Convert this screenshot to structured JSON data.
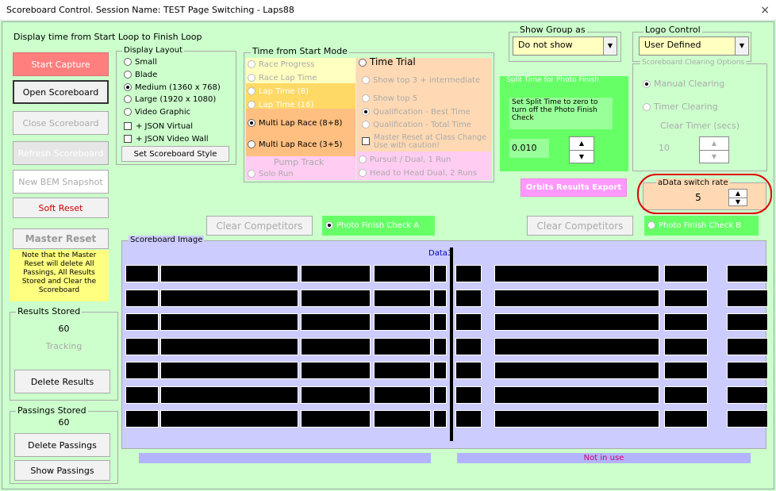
{
  "window": {
    "title": "Scoreboard Control.  Session Name: TEST Page Switching - Laps88",
    "close": "×"
  },
  "header": {
    "display_time": "Display time from Start Loop to Finish Loop"
  },
  "left_buttons": {
    "start_capture": "Start Capture",
    "open_scoreboard": "Open Scoreboard",
    "close_scoreboard": "Close Scoreboard",
    "refresh_scoreboard": "Refresh Scoreboard",
    "new_bem_snapshot": "New BEM Snapshot",
    "soft_reset": "Soft Reset",
    "master_reset": "Master Reset",
    "master_reset_note": "Note that the Master Reset will delete All Passings, All Results Stored and Clear the Scoreboard"
  },
  "display_layout": {
    "title": "Display Layout",
    "options": [
      "Small",
      "Blade",
      "Medium (1360 x 768)",
      "Large (1920 x 1080)",
      "Video Graphic"
    ],
    "selected": "Medium (1360 x 768)",
    "checks": [
      "+ JSON Virtual",
      "+ JSON Video Wall"
    ],
    "set_style": "Set Scoreboard Style"
  },
  "time_mode": {
    "title": "Time from Start Mode",
    "left_options": [
      "Race Progress",
      "Race Lap Time",
      "Lap Time (8)",
      "Lap Time (16)",
      "Multi Lap Race (8+8)",
      "Multi Lap Race (3+5)"
    ],
    "selected": "Multi Lap Race (8+8)",
    "pump_track": "Pump Track",
    "solo_run": "Solo Run",
    "time_trial": "Time Trial",
    "right_options": [
      "Show top 3 + intermediate",
      "Show top 5",
      "Qualification - Best Time",
      "Qualification - Total Time"
    ],
    "right_selected": "Qualification - Best Time",
    "master_reset_check": "Master Reset at Class Change Use with caution!",
    "pursuit": "Pursuit / Dual, 1 Run",
    "head_to_head": "Head to Head Dual, 2 Runs"
  },
  "show_group": {
    "title": "Show Group as",
    "value": "Do not show"
  },
  "logo_control": {
    "title": "Logo Control",
    "value": "User Defined"
  },
  "split_time": {
    "title": "Split Time for Photo Finish",
    "desc": "Set Split Time to zero to turn off the Photo Finish Check",
    "value": "0.010"
  },
  "clearing": {
    "title": "Scoreboard Clearing Options",
    "manual": "Manual Clearing",
    "timer": "Timer Clearing",
    "clear_timer_label": "Clear Timer (secs)",
    "clear_timer_value": "10"
  },
  "orbits_export": "Orbits Results Export",
  "adata": {
    "title": "aData switch rate",
    "value": "5"
  },
  "clear_competitors_a": "Clear Competitors",
  "photo_finish_a": "Photo Finish Check A",
  "clear_competitors_b": "Clear Competitors",
  "photo_finish_b": "Photo Finish Check B",
  "results_stored": {
    "title": "Results Stored",
    "count": "60",
    "tracking": "Tracking",
    "delete": "Delete Results"
  },
  "passings_stored": {
    "title": "Passings Stored",
    "count": "60",
    "delete": "Delete Passings",
    "show": "Show Passings"
  },
  "scoreboard_image": {
    "title": "Scoreboard Image",
    "data_label": "Data3",
    "not_in_use": "Not in use"
  },
  "colors": {
    "accent_pink": "#ff99cc",
    "bg_green": "#ccffcc",
    "peach": "#ffd9b3",
    "preview": "#ccccff"
  }
}
